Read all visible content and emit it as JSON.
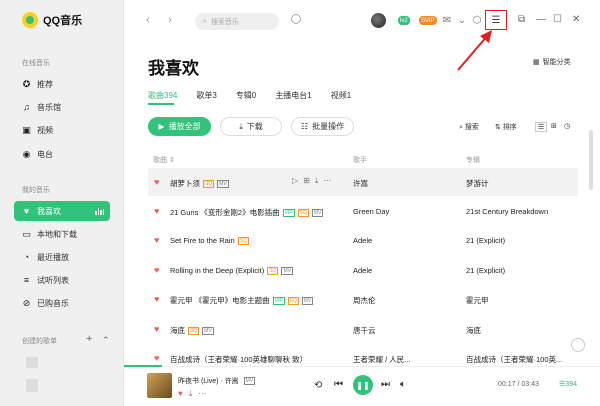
{
  "app": {
    "name": "QQ音乐"
  },
  "sidebar": {
    "online_section": "在线音乐",
    "online_items": [
      {
        "label": "推荐",
        "icon": "recommend-icon"
      },
      {
        "label": "音乐馆",
        "icon": "music-note-icon"
      },
      {
        "label": "视频",
        "icon": "video-icon"
      },
      {
        "label": "电台",
        "icon": "radio-icon"
      }
    ],
    "my_section": "我的音乐",
    "my_items": [
      {
        "label": "我喜欢",
        "icon": "heart-icon",
        "active": true
      },
      {
        "label": "本地和下载",
        "icon": "monitor-icon"
      },
      {
        "label": "最近播放",
        "icon": "clock-icon"
      },
      {
        "label": "试听列表",
        "icon": "list-icon"
      },
      {
        "label": "已购音乐",
        "icon": "coupon-icon"
      }
    ],
    "created_section": "创建的歌单",
    "add_label": "+",
    "collapse_label": "⌃"
  },
  "topbar": {
    "search_placeholder": "搜索音乐",
    "badge_green": "lv2",
    "badge_orange": "SVIP"
  },
  "page": {
    "title": "我喜欢",
    "smart_sort": "智能分类",
    "tabs": [
      "歌曲394",
      "歌单3",
      "专辑0",
      "主播电台1",
      "视频1"
    ],
    "active_tab": 0,
    "buttons": {
      "play_all": "播放全部",
      "download": "下载",
      "batch": "批量操作"
    },
    "tools": {
      "search": "搜索",
      "sort": "排序"
    },
    "columns": {
      "song": "歌曲 ⇕",
      "artist": "歌手",
      "album": "专辑"
    }
  },
  "songs": [
    {
      "title": "胡萝卜须",
      "tags": [
        "SQ",
        "MV"
      ],
      "artist": "许嵩",
      "album": "梦游计"
    },
    {
      "title": "21 Guns 《变形金刚2》电影插曲",
      "tags": [
        "VIP",
        "SQ",
        "MV"
      ],
      "artist": "Green Day",
      "album": "21st Century Breakdown"
    },
    {
      "title": "Set Fire to the Rain",
      "tags": [
        "SQ"
      ],
      "artist": "Adele",
      "album": "21 (Explicit)"
    },
    {
      "title": "Rolling in the Deep (Explicit)",
      "tags": [
        "SQ",
        "MV"
      ],
      "artist": "Adele",
      "album": "21 (Explicit)"
    },
    {
      "title": "霍元甲 《霍元甲》电影主题曲",
      "tags": [
        "VIP",
        "SQ",
        "MV"
      ],
      "artist": "周杰伦",
      "album": "霍元甲"
    },
    {
      "title": "海底",
      "tags": [
        "SQ",
        "MV"
      ],
      "artist": "唐千云",
      "album": "海底"
    },
    {
      "title": "百战成诗（王者荣耀·100英雄聊聊秋 致）",
      "tags": [],
      "artist": "王者荣耀 / 人民...",
      "album": "百战成诗（王者荣耀·100英..."
    }
  ],
  "player": {
    "title": "昨夜书 (Live)",
    "artist": "许嵩",
    "time": "00:17 / 03:43",
    "queue_count": "394",
    "progress": 0.08
  },
  "colors": {
    "accent": "#31c27c",
    "heart": "#f05a5a",
    "highlight_box": "#e02020"
  }
}
